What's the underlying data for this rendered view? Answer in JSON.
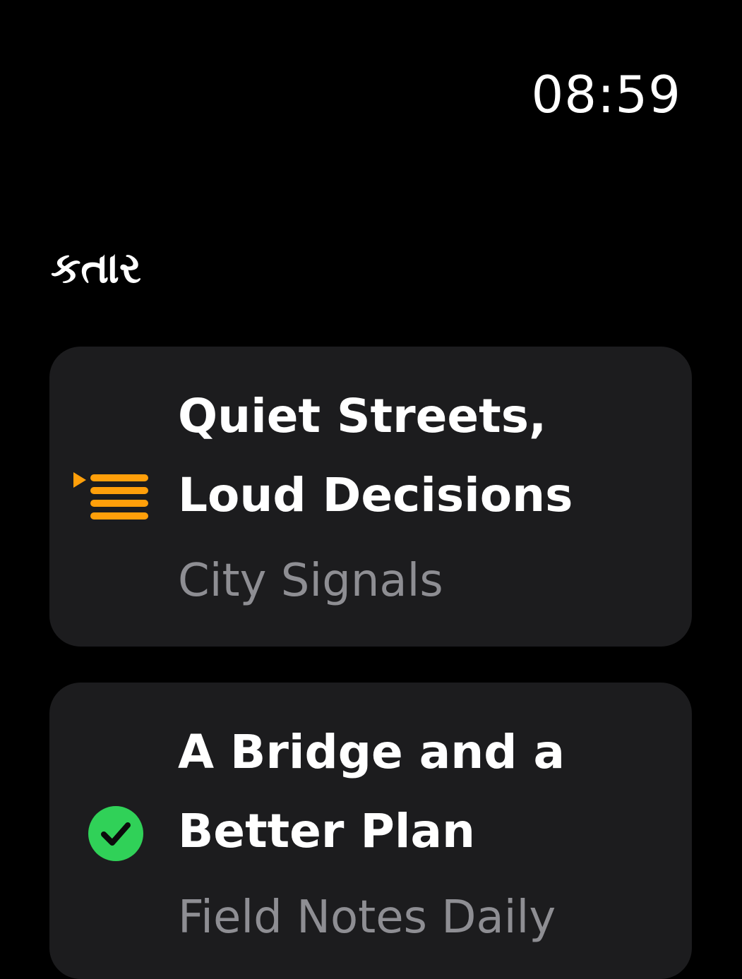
{
  "status_bar": {
    "time": "08:59"
  },
  "page": {
    "title": "કતાર"
  },
  "queue": [
    {
      "title_line1": "Quiet Streets,",
      "title_line2": "Loud Decisions",
      "show": "City Signals",
      "status_icon": "now-playing-queue-icon",
      "icon_color": "#ff9f0a"
    },
    {
      "title_line1": "A Bridge and a",
      "title_line2": "Better Plan",
      "show": "Field Notes Daily",
      "status_icon": "played-checkmark-icon",
      "icon_color": "#30d158"
    }
  ]
}
